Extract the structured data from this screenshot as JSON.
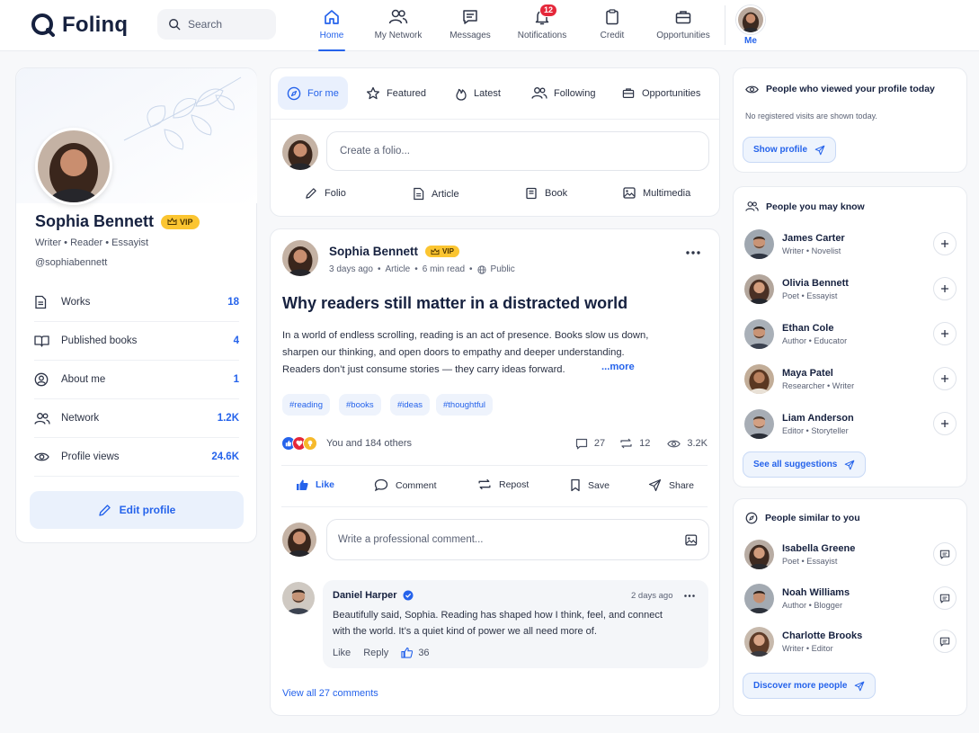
{
  "brand": {
    "name": "Folinq",
    "accent": "#2563eb"
  },
  "search": {
    "placeholder": "Search"
  },
  "nav": {
    "home": "Home",
    "network": "My Network",
    "messages": "Messages",
    "notifications": "Notifications",
    "notification_count": "12",
    "credit": "Credit",
    "opportunities": "Opportunities",
    "me": "Me"
  },
  "profile": {
    "name": "Sophia Bennett",
    "vip": "VIP",
    "subtitle": "Writer • Reader • Essayist",
    "handle": "@sophiabennett",
    "stats": [
      {
        "label": "Works",
        "value": "18",
        "icon": "document-icon"
      },
      {
        "label": "Published books",
        "value": "4",
        "icon": "open-book-icon"
      },
      {
        "label": "About me",
        "value": "1",
        "icon": "user-circle-icon"
      },
      {
        "label": "Network",
        "value": "1.2K",
        "icon": "users-icon"
      },
      {
        "label": "Profile views",
        "value": "24.6K",
        "icon": "eye-icon"
      }
    ],
    "edit_label": "Edit profile"
  },
  "feed": {
    "tabs": [
      "For me",
      "Featured",
      "Latest",
      "Following",
      "Opportunities"
    ],
    "compose": {
      "placeholder": "Create a folio...",
      "actions": [
        "Folio",
        "Article",
        "Book",
        "Multimedia"
      ]
    }
  },
  "post": {
    "author": "Sophia Bennett",
    "vip": "VIP",
    "time": "3 days ago",
    "type": "Article",
    "read_time": "6 min read",
    "visibility": "Public",
    "title": "Why readers still matter in a distracted world",
    "body_lines": [
      "In a world of endless scrolling, reading is an act of presence. Books slow us down,",
      "sharpen our thinking, and open doors to empathy and deeper understanding.",
      "Readers don’t just consume stories — they carry ideas forward."
    ],
    "more": "...more",
    "tags": [
      "#reading",
      "#books",
      "#ideas",
      "#thoughtful"
    ],
    "reactions_text": "You and 184 others",
    "comments_count": "27",
    "reposts_count": "12",
    "views_count": "3.2K",
    "actions": [
      "Like",
      "Comment",
      "Repost",
      "Save",
      "Share"
    ],
    "comment_placeholder": "Write a professional comment...",
    "comment": {
      "author": "Daniel Harper",
      "time": "2 days ago",
      "lines": [
        "Beautifully said, Sophia. Reading has shaped how I think, feel, and connect",
        "with the world. It’s a quiet kind of power we all need more of."
      ],
      "like": "Like",
      "reply": "Reply",
      "likes": "36"
    },
    "view_all": "View all 27 comments"
  },
  "viewers": {
    "title": "People who viewed your profile today",
    "note": "No registered visits are shown today.",
    "button": "Show profile"
  },
  "suggestions": {
    "title": "People you may know",
    "people": [
      {
        "name": "James Carter",
        "role": "Writer • Novelist"
      },
      {
        "name": "Olivia Bennett",
        "role": "Poet • Essayist"
      },
      {
        "name": "Ethan Cole",
        "role": "Author • Educator"
      },
      {
        "name": "Maya Patel",
        "role": "Researcher • Writer"
      },
      {
        "name": "Liam Anderson",
        "role": "Editor • Storyteller"
      }
    ],
    "button": "See all suggestions"
  },
  "similar": {
    "title": "People similar to you",
    "people": [
      {
        "name": "Isabella Greene",
        "role": "Poet • Essayist"
      },
      {
        "name": "Noah Williams",
        "role": "Author • Blogger"
      },
      {
        "name": "Charlotte Brooks",
        "role": "Writer • Editor"
      }
    ],
    "button": "Discover more people"
  }
}
